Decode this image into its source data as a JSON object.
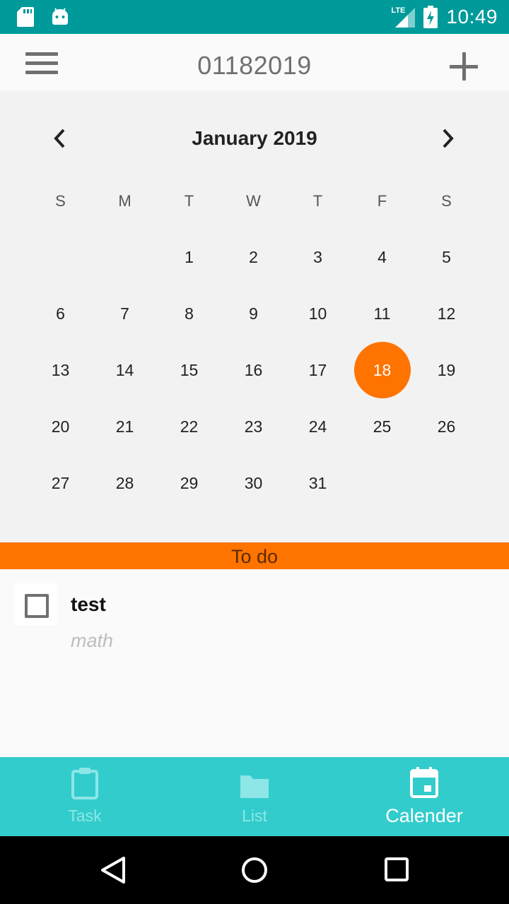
{
  "status_bar": {
    "time": "10:49",
    "network": "LTE",
    "icons": [
      "sd-card-icon",
      "android-icon",
      "signal-icon",
      "battery-charging-icon"
    ]
  },
  "toolbar": {
    "title": "01182019",
    "menu_icon": "hamburger-menu-icon",
    "add_icon": "plus-icon"
  },
  "calendar": {
    "month_label": "January 2019",
    "weekdays": [
      "S",
      "M",
      "T",
      "W",
      "T",
      "F",
      "S"
    ],
    "selected_day": "18",
    "days": [
      "",
      "",
      "1",
      "2",
      "3",
      "4",
      "5",
      "6",
      "7",
      "8",
      "9",
      "10",
      "11",
      "12",
      "13",
      "14",
      "15",
      "16",
      "17",
      "18",
      "19",
      "20",
      "21",
      "22",
      "23",
      "24",
      "25",
      "26",
      "27",
      "28",
      "29",
      "30",
      "31",
      "",
      ""
    ]
  },
  "todo": {
    "header": "To do",
    "tasks": [
      {
        "title": "test",
        "subtitle": "math",
        "checked": false
      }
    ]
  },
  "bottom_nav": {
    "items": [
      {
        "label": "Task",
        "icon": "clipboard-icon",
        "active": false
      },
      {
        "label": "List",
        "icon": "folder-icon",
        "active": false
      },
      {
        "label": "Calender",
        "icon": "calendar-icon",
        "active": true
      }
    ]
  },
  "colors": {
    "status_bar": "#009a9a",
    "accent": "#ff7300",
    "bottom_nav": "#33cccc",
    "calendar_bg": "#f2f2f2"
  }
}
